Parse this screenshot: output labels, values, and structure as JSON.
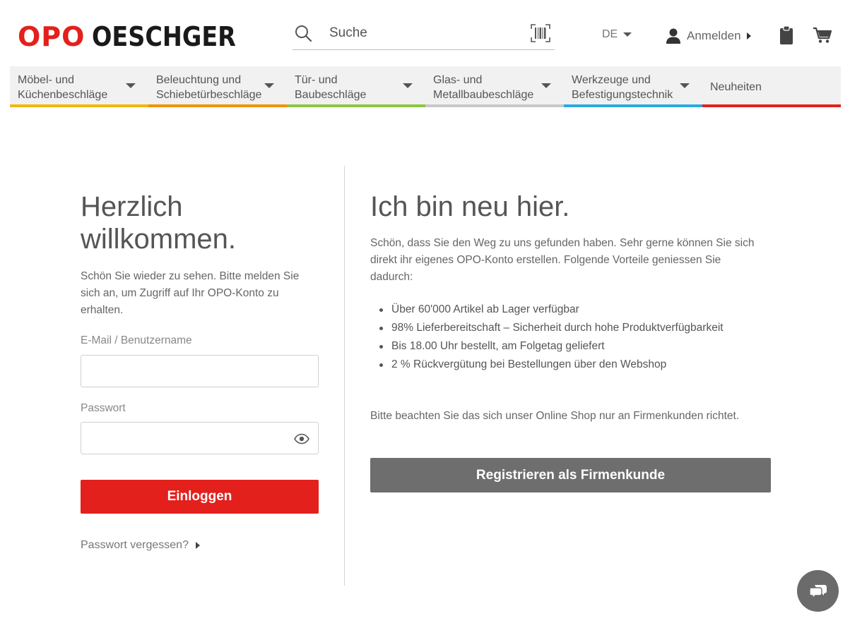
{
  "brand": {
    "logo_part1": "OPO",
    "logo_part2": "OESCHGER",
    "accent_color": "#e3201c"
  },
  "header": {
    "search_placeholder": "Suche",
    "language": "DE",
    "login_label": "Anmelden"
  },
  "nav": {
    "items": [
      {
        "line1": "Möbel- und",
        "line2": "Küchenbeschläge",
        "color": "#f2b705"
      },
      {
        "line1": "Beleuchtung und",
        "line2": "Schiebetürbeschläge",
        "color": "#f39200"
      },
      {
        "line1": "Tür- und",
        "line2": "Baubeschläge",
        "color": "#8cc63f"
      },
      {
        "line1": "Glas- und",
        "line2": "Metallbaubeschläge",
        "color": "#c8c8c8"
      },
      {
        "line1": "Werkzeuge und",
        "line2": "Befestigungstechnik",
        "color": "#29a9e1"
      },
      {
        "line1": "Neuheiten",
        "color": "#e3201c"
      }
    ]
  },
  "login": {
    "title_line1": "Herzlich",
    "title_line2": "willkommen.",
    "intro": "Schön Sie wieder zu sehen. Bitte melden Sie sich an, um Zugriff auf Ihr OPO-Konto zu erhalten.",
    "email_label": "E-Mail / Benutzername",
    "email_value": "",
    "password_label": "Passwort",
    "password_value": "",
    "submit_label": "Einloggen",
    "forgot_label": "Passwort vergessen?"
  },
  "register": {
    "title": "Ich bin neu hier.",
    "intro": "Schön, dass Sie den Weg zu uns gefunden haben. Sehr gerne können Sie sich direkt ihr eigenes OPO-Konto erstellen. Folgende Vorteile geniessen Sie dadurch:",
    "benefits": [
      "Über 60'000 Artikel ab Lager verfügbar",
      "98% Lieferbereitschaft – Sicherheit durch hohe Produktverfügbarkeit",
      "Bis 18.00 Uhr bestellt, am Folgetag geliefert",
      "2 % Rückvergütung bei Bestellungen über den Webshop"
    ],
    "notice": "Bitte beachten Sie das sich unser Online Shop nur an Firmenkunden richtet.",
    "button_label": "Registrieren als Firmenkunde"
  },
  "icons": {
    "search": "search-icon",
    "barcode": "barcode-icon",
    "user": "user-icon",
    "clipboard": "clipboard-icon",
    "cart": "cart-icon",
    "eye": "eye-icon",
    "chat": "chat-icon"
  }
}
